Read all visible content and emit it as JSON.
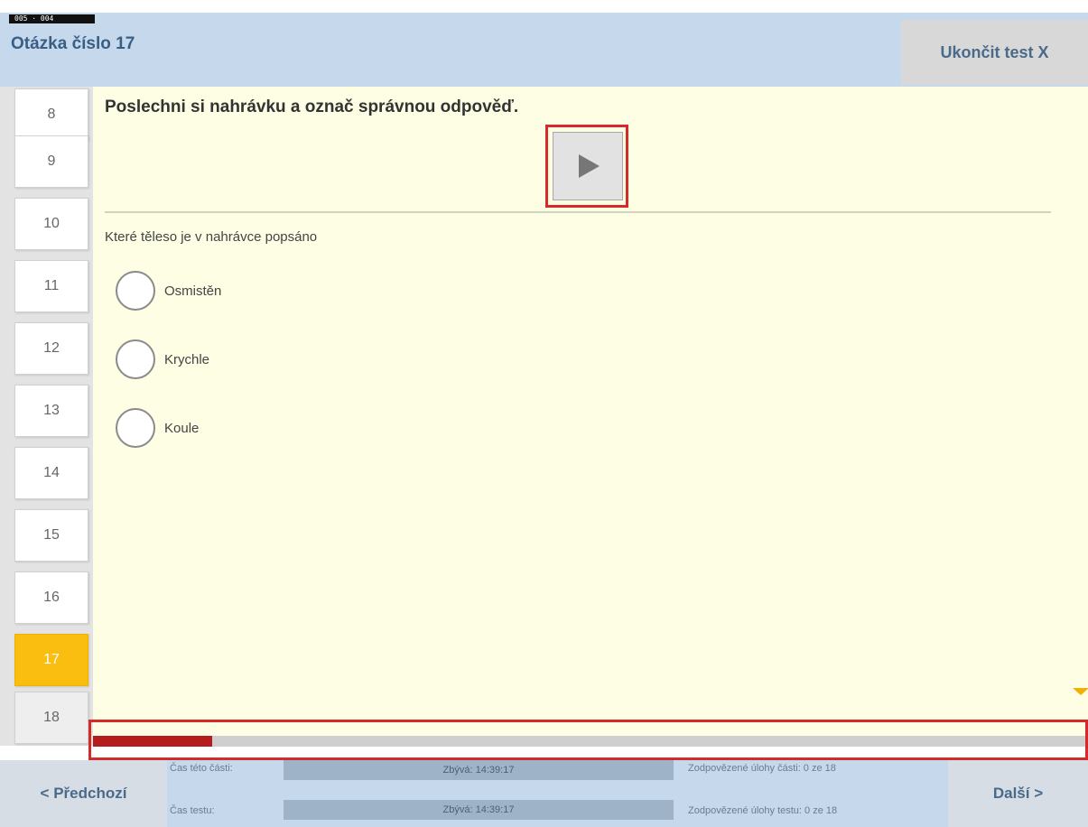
{
  "badge": "005 · 004",
  "header": {
    "title": "Otázka číslo 17",
    "end_test": "Ukončit test  X"
  },
  "sidebar": {
    "items": [
      "8",
      "9",
      "10",
      "11",
      "12",
      "13",
      "14",
      "15",
      "16",
      "17",
      "18"
    ],
    "active": "17"
  },
  "content": {
    "instruction": "Poslechni si nahrávku a označ správnou odpověď.",
    "question": "Které těleso je v nahrávce popsáno",
    "options": [
      "Osmistěn",
      "Krychle",
      "Koule"
    ]
  },
  "progress": {
    "fraction": 0.12
  },
  "footer": {
    "prev": "< Předchozí",
    "next": "Další >",
    "part_time_label": "Čas této části:",
    "part_time_value": "Zbývá: 14:39:17",
    "part_answered": "Zodpovězené úlohy části: 0 ze 18",
    "test_time_label": "Čas testu:",
    "test_time_value": "Zbývá: 14:39:17",
    "test_answered": "Zodpovězené úlohy testu: 0 ze 18"
  },
  "colors": {
    "accent": "#f9be10",
    "progress_fill": "#b51d1d",
    "highlight": "#d42a2a"
  },
  "icons": {
    "play": "play-icon",
    "scroll": "scroll-down-icon"
  }
}
